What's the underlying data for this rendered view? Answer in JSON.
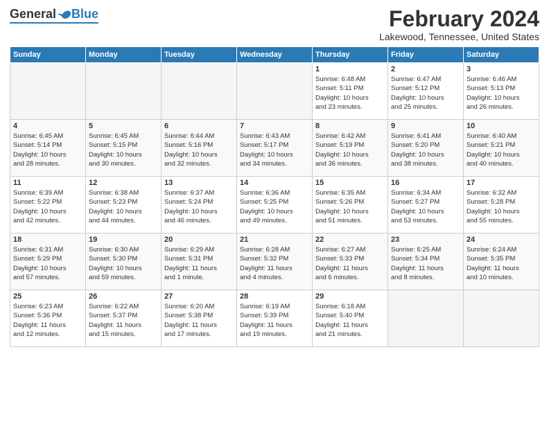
{
  "logo": {
    "general": "General",
    "blue": "Blue"
  },
  "title": "February 2024",
  "subtitle": "Lakewood, Tennessee, United States",
  "headers": [
    "Sunday",
    "Monday",
    "Tuesday",
    "Wednesday",
    "Thursday",
    "Friday",
    "Saturday"
  ],
  "weeks": [
    [
      {
        "day": "",
        "empty": true
      },
      {
        "day": "",
        "empty": true
      },
      {
        "day": "",
        "empty": true
      },
      {
        "day": "",
        "empty": true
      },
      {
        "day": "1",
        "sunrise": "6:48 AM",
        "sunset": "5:11 PM",
        "daylight": "10 hours and 23 minutes."
      },
      {
        "day": "2",
        "sunrise": "6:47 AM",
        "sunset": "5:12 PM",
        "daylight": "10 hours and 25 minutes."
      },
      {
        "day": "3",
        "sunrise": "6:46 AM",
        "sunset": "5:13 PM",
        "daylight": "10 hours and 26 minutes."
      }
    ],
    [
      {
        "day": "4",
        "sunrise": "6:45 AM",
        "sunset": "5:14 PM",
        "daylight": "10 hours and 28 minutes."
      },
      {
        "day": "5",
        "sunrise": "6:45 AM",
        "sunset": "5:15 PM",
        "daylight": "10 hours and 30 minutes."
      },
      {
        "day": "6",
        "sunrise": "6:44 AM",
        "sunset": "5:16 PM",
        "daylight": "10 hours and 32 minutes."
      },
      {
        "day": "7",
        "sunrise": "6:43 AM",
        "sunset": "5:17 PM",
        "daylight": "10 hours and 34 minutes."
      },
      {
        "day": "8",
        "sunrise": "6:42 AM",
        "sunset": "5:19 PM",
        "daylight": "10 hours and 36 minutes."
      },
      {
        "day": "9",
        "sunrise": "6:41 AM",
        "sunset": "5:20 PM",
        "daylight": "10 hours and 38 minutes."
      },
      {
        "day": "10",
        "sunrise": "6:40 AM",
        "sunset": "5:21 PM",
        "daylight": "10 hours and 40 minutes."
      }
    ],
    [
      {
        "day": "11",
        "sunrise": "6:39 AM",
        "sunset": "5:22 PM",
        "daylight": "10 hours and 42 minutes."
      },
      {
        "day": "12",
        "sunrise": "6:38 AM",
        "sunset": "5:23 PM",
        "daylight": "10 hours and 44 minutes."
      },
      {
        "day": "13",
        "sunrise": "6:37 AM",
        "sunset": "5:24 PM",
        "daylight": "10 hours and 46 minutes."
      },
      {
        "day": "14",
        "sunrise": "6:36 AM",
        "sunset": "5:25 PM",
        "daylight": "10 hours and 49 minutes."
      },
      {
        "day": "15",
        "sunrise": "6:35 AM",
        "sunset": "5:26 PM",
        "daylight": "10 hours and 51 minutes."
      },
      {
        "day": "16",
        "sunrise": "6:34 AM",
        "sunset": "5:27 PM",
        "daylight": "10 hours and 53 minutes."
      },
      {
        "day": "17",
        "sunrise": "6:32 AM",
        "sunset": "5:28 PM",
        "daylight": "10 hours and 55 minutes."
      }
    ],
    [
      {
        "day": "18",
        "sunrise": "6:31 AM",
        "sunset": "5:29 PM",
        "daylight": "10 hours and 57 minutes."
      },
      {
        "day": "19",
        "sunrise": "6:30 AM",
        "sunset": "5:30 PM",
        "daylight": "10 hours and 59 minutes."
      },
      {
        "day": "20",
        "sunrise": "6:29 AM",
        "sunset": "5:31 PM",
        "daylight": "11 hours and 1 minute."
      },
      {
        "day": "21",
        "sunrise": "6:28 AM",
        "sunset": "5:32 PM",
        "daylight": "11 hours and 4 minutes."
      },
      {
        "day": "22",
        "sunrise": "6:27 AM",
        "sunset": "5:33 PM",
        "daylight": "11 hours and 6 minutes."
      },
      {
        "day": "23",
        "sunrise": "6:25 AM",
        "sunset": "5:34 PM",
        "daylight": "11 hours and 8 minutes."
      },
      {
        "day": "24",
        "sunrise": "6:24 AM",
        "sunset": "5:35 PM",
        "daylight": "11 hours and 10 minutes."
      }
    ],
    [
      {
        "day": "25",
        "sunrise": "6:23 AM",
        "sunset": "5:36 PM",
        "daylight": "11 hours and 12 minutes."
      },
      {
        "day": "26",
        "sunrise": "6:22 AM",
        "sunset": "5:37 PM",
        "daylight": "11 hours and 15 minutes."
      },
      {
        "day": "27",
        "sunrise": "6:20 AM",
        "sunset": "5:38 PM",
        "daylight": "11 hours and 17 minutes."
      },
      {
        "day": "28",
        "sunrise": "6:19 AM",
        "sunset": "5:39 PM",
        "daylight": "11 hours and 19 minutes."
      },
      {
        "day": "29",
        "sunrise": "6:18 AM",
        "sunset": "5:40 PM",
        "daylight": "11 hours and 21 minutes."
      },
      {
        "day": "",
        "empty": true
      },
      {
        "day": "",
        "empty": true
      }
    ]
  ],
  "labels": {
    "sunrise": "Sunrise:",
    "sunset": "Sunset:",
    "daylight": "Daylight:"
  }
}
